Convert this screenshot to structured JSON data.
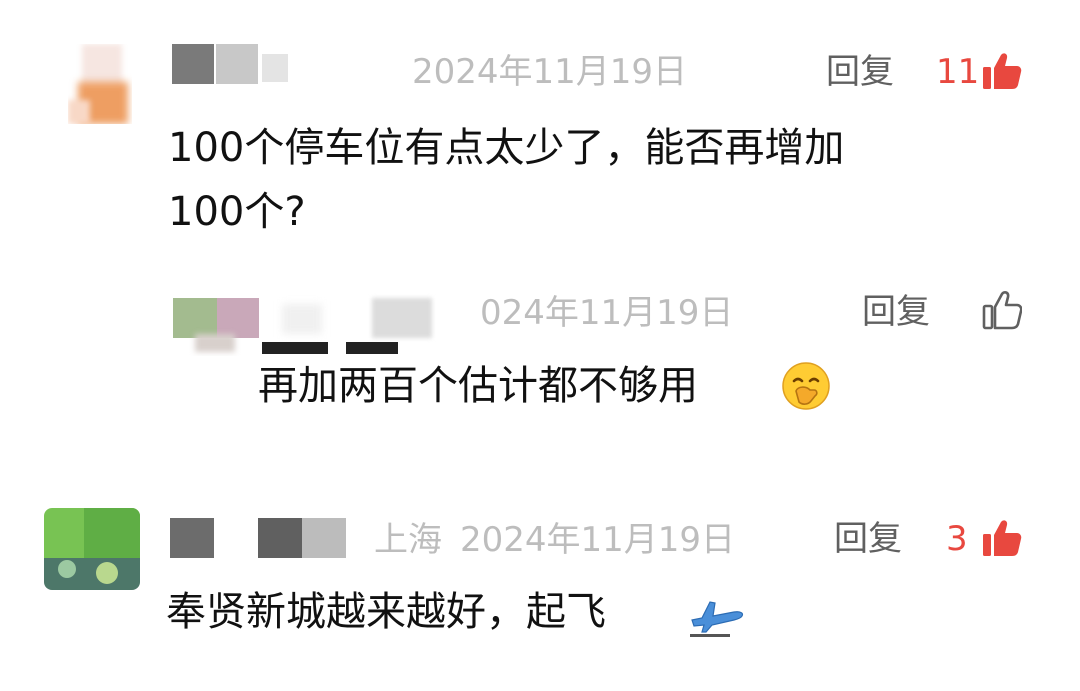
{
  "comments": [
    {
      "date": "2024年11月19日",
      "reply_label": "回复",
      "likes": "11",
      "text_line1": "100个停车位有点太少了，能否再增加",
      "text_line2": "100个?"
    },
    {
      "date": "024年11月19日",
      "reply_label": "回复",
      "text": "再加两百个估计都不够用"
    },
    {
      "location": "上海",
      "date": "2024年11月19日",
      "reply_label": "回复",
      "likes": "3",
      "text": "奉贤新城越来越好，起飞"
    }
  ],
  "icons": {
    "like_filled": "thumbs-up-filled-icon",
    "like_outline": "thumbs-up-outline-icon",
    "face_emoji": "face-with-hand-over-mouth-emoji",
    "plane_emoji": "airplane-departure-emoji"
  },
  "colors": {
    "like_active": "#e8483f",
    "meta_gray": "#bdbdbd",
    "reply_gray": "#606060"
  }
}
